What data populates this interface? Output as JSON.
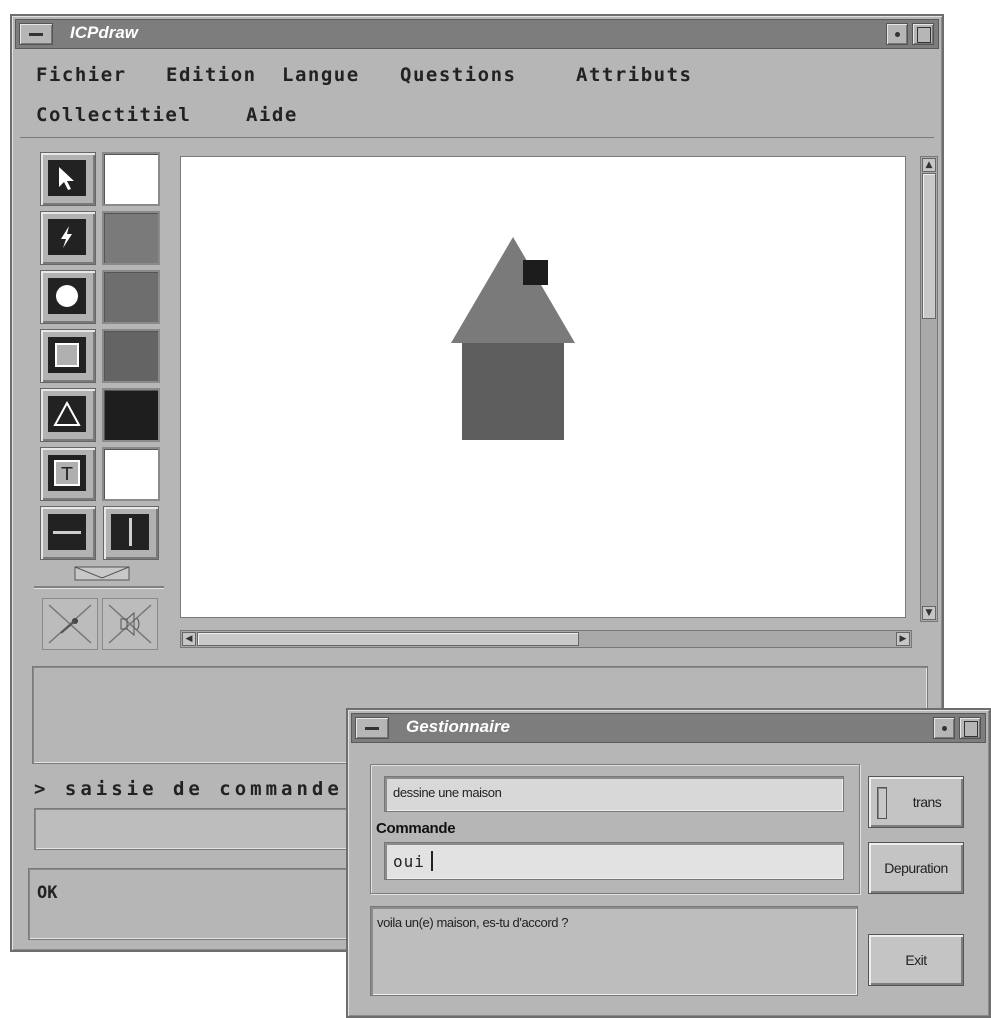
{
  "main_window": {
    "title": "ICPdraw",
    "menu": {
      "row1": [
        "Fichier",
        "Edition",
        "Langue",
        "Questions",
        "Attributs"
      ],
      "row2": [
        "Collectitiel",
        "Aide"
      ]
    },
    "tools": [
      "select-arrow-icon",
      "lightning-icon",
      "circle-tool-icon",
      "square-tool-icon",
      "triangle-tool-icon",
      "text-tool-icon",
      "horizontal-line-icon",
      "vertical-line-icon"
    ],
    "text_tool_glyph": "T",
    "swatch_colors": [
      "#ffffff",
      "#7a7a7a",
      "#6e6e6e",
      "#646464",
      "#1e1e1e",
      "#ffffff"
    ],
    "command_prompt": "> saisie de commande",
    "command_input": "",
    "status_text": "OK",
    "house": {
      "roof_color": "#7a7a7a",
      "body_color": "#5e5e5e",
      "chimney_color": "#1c1c1c"
    }
  },
  "dialog": {
    "title": "Gestionnaire",
    "input_text": "dessine une maison",
    "command_label": "Commande",
    "command_value": "oui",
    "response_text": "voila un(e) maison, es-tu d'accord ?",
    "buttons": {
      "trans": "trans",
      "depuration": "Depuration",
      "exit": "Exit"
    }
  }
}
